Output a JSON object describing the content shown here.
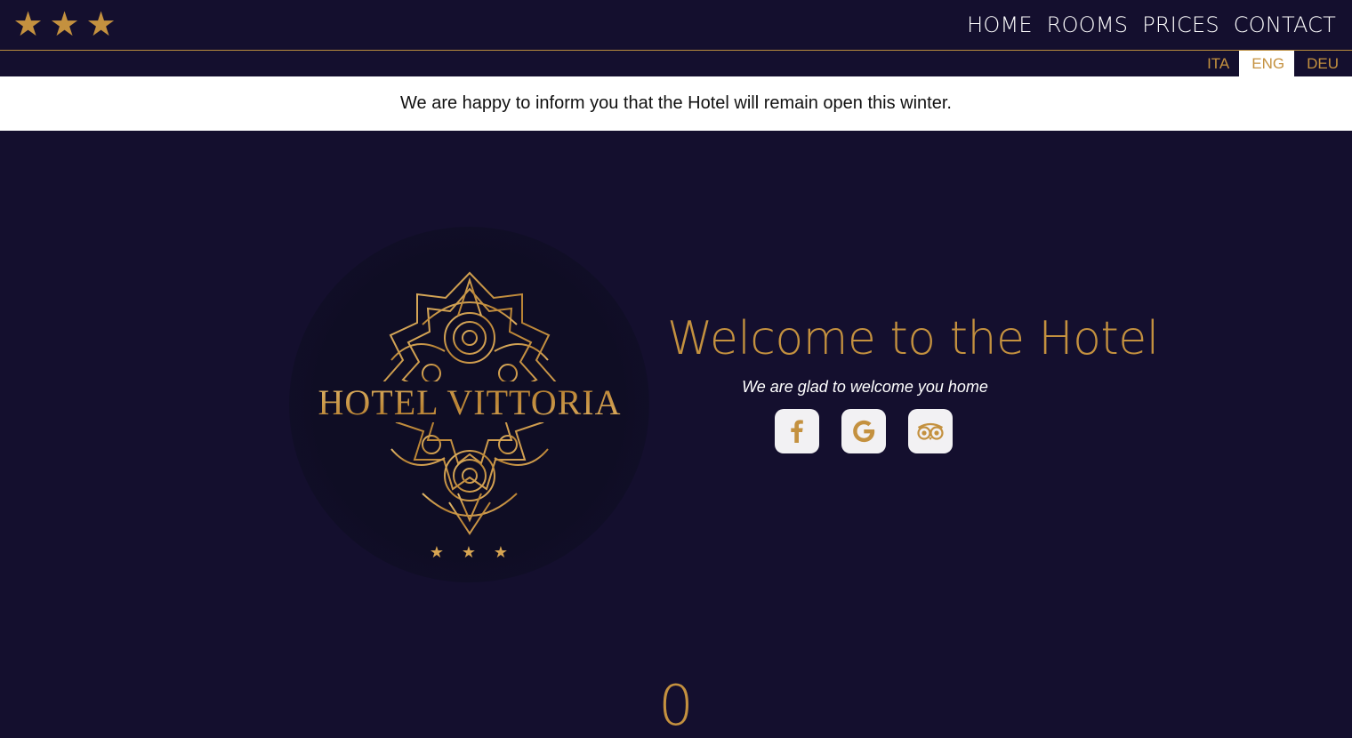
{
  "header": {
    "star_rating": 3,
    "stars": [
      "★",
      "★",
      "★"
    ],
    "nav": [
      "HOME",
      "ROOMS",
      "PRICES",
      "CONTACT"
    ],
    "languages": [
      {
        "label": "ITA",
        "active": false
      },
      {
        "label": "ENG",
        "active": true
      },
      {
        "label": "DEU",
        "active": false
      }
    ]
  },
  "notice": {
    "text": "We are happy to inform you that the Hotel will remain open this winter."
  },
  "hero": {
    "logo_text": "HOTEL VITTORIA",
    "logo_stars": [
      "★",
      "★",
      "★"
    ],
    "title": "Welcome to the Hotel",
    "subtitle": "We are glad to welcome you home",
    "social": [
      {
        "icon": "facebook-icon"
      },
      {
        "icon": "google-icon"
      },
      {
        "icon": "tripadvisor-icon"
      }
    ]
  },
  "counter": {
    "value": "0"
  },
  "colors": {
    "background": "#140f2e",
    "gold": "#c4913f",
    "white": "#ffffff"
  }
}
